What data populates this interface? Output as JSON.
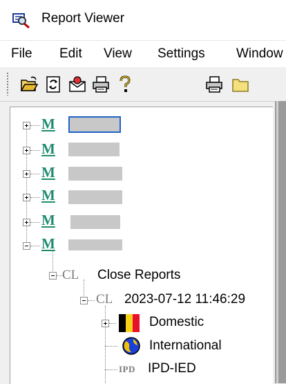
{
  "window": {
    "title": "Report Viewer",
    "app_icon": "magnifier-report-icon"
  },
  "menu": [
    "File",
    "Edit",
    "View",
    "Settings",
    "Window"
  ],
  "toolbar": {
    "buttons": [
      "open-folder-icon",
      "refresh-icon",
      "mail-icon",
      "print-icon",
      "help-icon",
      "print-icon",
      "folder-icon"
    ]
  },
  "tree": {
    "m_label": "M",
    "cl_label": "CL",
    "ipd_label": "IPD",
    "close_reports": "Close Reports",
    "timestamp": "2023-07-12 11:46:29",
    "domestic": "Domestic",
    "international": "International",
    "ipd_ied": "IPD-IED"
  },
  "colors": {
    "m_icon": "#1f8b6e",
    "selection_border": "#1e64c8",
    "flag_black": "#000000",
    "flag_yellow": "#f7d117",
    "flag_red": "#e8112d",
    "globe_blue": "#1a3fd6",
    "globe_yellow": "#f2c200"
  }
}
